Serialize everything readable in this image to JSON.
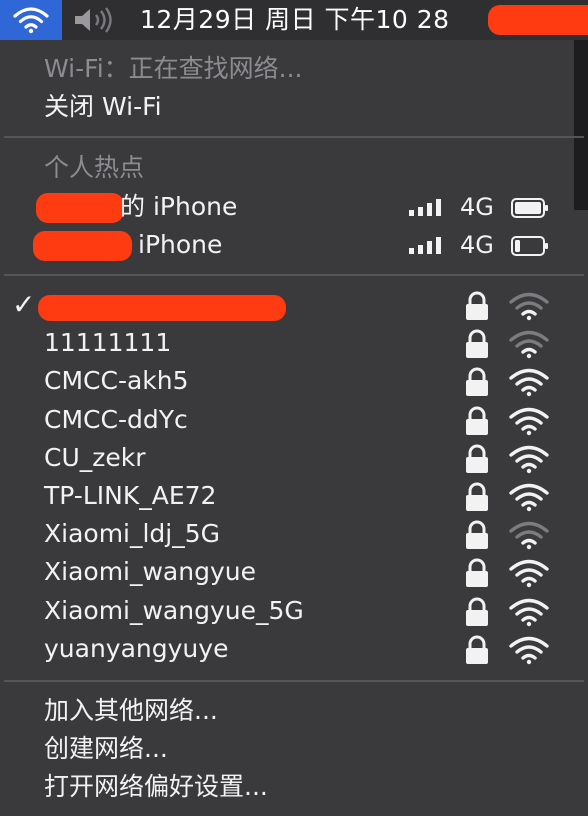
{
  "menubar": {
    "wifi_icon": "wifi-icon",
    "volume_icon": "speaker-muted-icon",
    "clock": "12月29日 周日 下午10 28"
  },
  "wifi_status": {
    "searching": "Wi-Fi：正在查找网络...",
    "turn_off": "关闭 Wi-Fi"
  },
  "hotspot": {
    "header": "个人热点",
    "devices": [
      {
        "name": "的 iPhone",
        "network": "4G",
        "signal_bars": 4,
        "battery": 0.85
      },
      {
        "name": "iPhone",
        "network": "4G",
        "signal_bars": 4,
        "battery": 0.2
      }
    ]
  },
  "networks": [
    {
      "name": "",
      "connected": true,
      "locked": true,
      "strength": 0.4
    },
    {
      "name": "11111111",
      "connected": false,
      "locked": true,
      "strength": 0.4
    },
    {
      "name": "CMCC-akh5",
      "connected": false,
      "locked": true,
      "strength": 1.0
    },
    {
      "name": "CMCC-ddYc",
      "connected": false,
      "locked": true,
      "strength": 1.0
    },
    {
      "name": "CU_zekr",
      "connected": false,
      "locked": true,
      "strength": 1.0
    },
    {
      "name": "TP-LINK_AE72",
      "connected": false,
      "locked": true,
      "strength": 1.0
    },
    {
      "name": "Xiaomi_ldj_5G",
      "connected": false,
      "locked": true,
      "strength": 0.4
    },
    {
      "name": "Xiaomi_wangyue",
      "connected": false,
      "locked": true,
      "strength": 1.0
    },
    {
      "name": "Xiaomi_wangyue_5G",
      "connected": false,
      "locked": true,
      "strength": 1.0
    },
    {
      "name": "yuanyangyuye",
      "connected": false,
      "locked": true,
      "strength": 1.0
    }
  ],
  "actions": {
    "join_other": "加入其他网络...",
    "create": "创建网络...",
    "open_prefs": "打开网络偏好设置..."
  },
  "colors": {
    "accent": "#2f68d6",
    "redaction": "#ff3b12",
    "menu_bg": "#3a3a3d",
    "dim_text": "#8c8c90"
  }
}
